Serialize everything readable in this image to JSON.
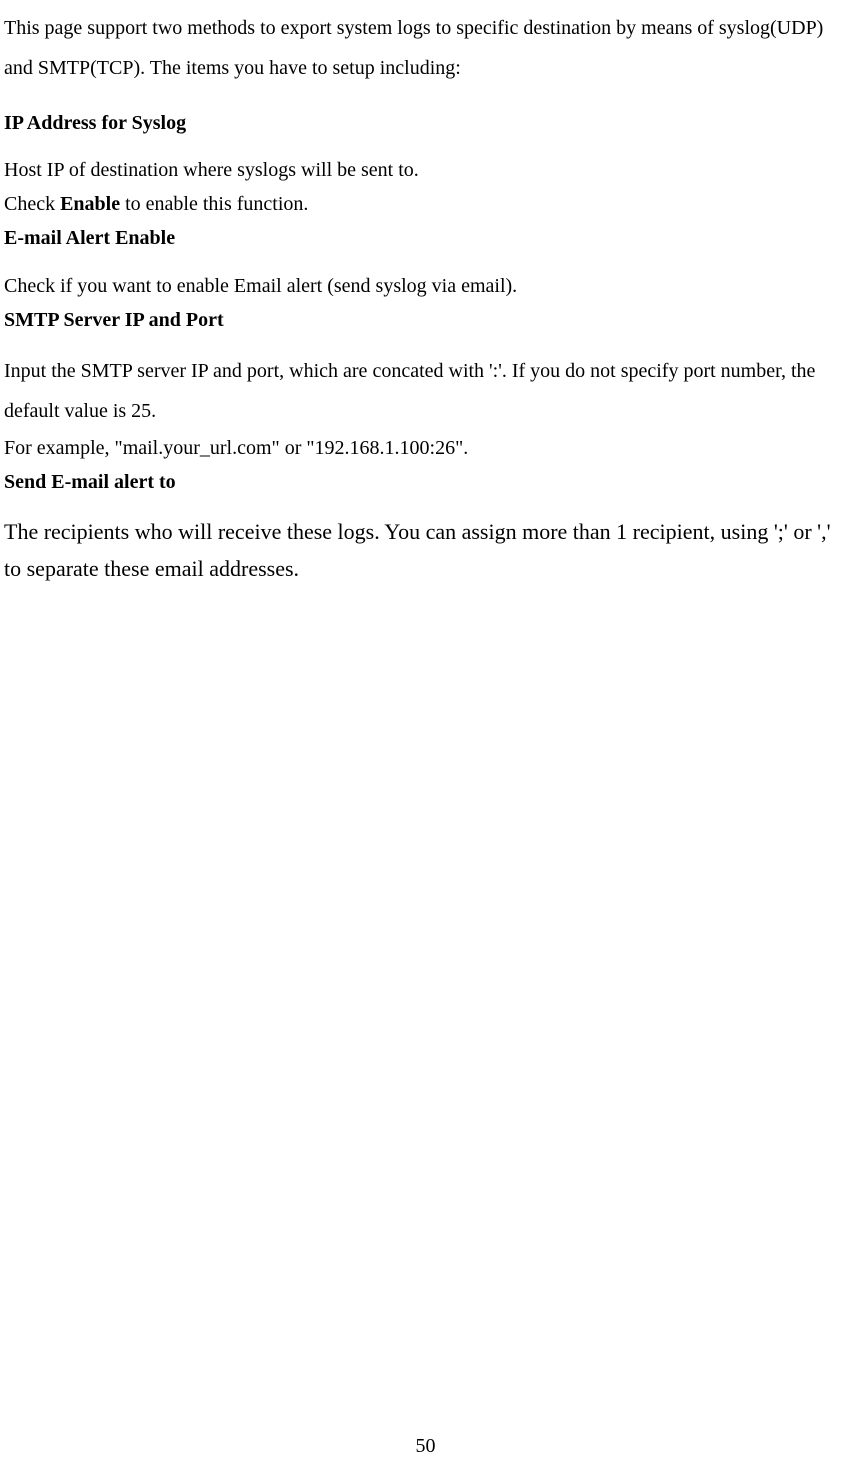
{
  "intro": "This page support two methods to export system logs to specific destination by means of syslog(UDP) and SMTP(TCP). The items you have to setup including:",
  "heading_ip": "IP Address for Syslog",
  "ip_desc_1": "Host IP of destination where syslogs will be sent to.",
  "ip_desc_2a": "Check ",
  "ip_desc_2b": "Enable",
  "ip_desc_2c": " to enable this function.",
  "heading_email": "E-mail Alert Enable",
  "email_desc": "Check if you want to enable Email alert (send syslog via email).",
  "heading_smtp": "SMTP Server IP and Port",
  "smtp_desc_1": "Input the SMTP server IP and port, which are concated with ':'. If you do not specify port number, the default value is 25.",
  "smtp_desc_2": "For example, \"mail.your_url.com\" or \"192.168.1.100:26\".",
  "heading_send": "Send E-mail alert to",
  "send_desc": "The recipients who will receive these logs. You can assign more than 1 recipient, using ';' or ',' to separate these email addresses.",
  "page_number": "50"
}
